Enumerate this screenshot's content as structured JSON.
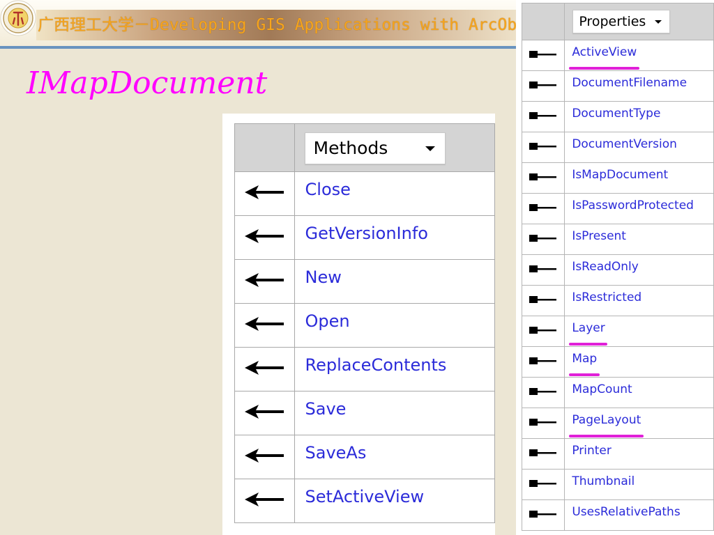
{
  "header": {
    "text": "广西理工大学－Developing GIS Applications with ArcObjects"
  },
  "page": {
    "title": "IMapDocument"
  },
  "methods_panel": {
    "dropdown_label": "Methods",
    "items": [
      {
        "label": "Close"
      },
      {
        "label": "GetVersionInfo"
      },
      {
        "label": "New"
      },
      {
        "label": "Open"
      },
      {
        "label": "ReplaceContents"
      },
      {
        "label": "Save"
      },
      {
        "label": "SaveAs"
      },
      {
        "label": "SetActiveView"
      }
    ],
    "icon": "method-arrow-icon"
  },
  "properties_panel": {
    "dropdown_label": "Properties",
    "icon": "property-arrow-icon",
    "highlight_color": "#e020d8",
    "items": [
      {
        "label": "ActiveView",
        "highlighted": true
      },
      {
        "label": "DocumentFilename",
        "highlighted": false
      },
      {
        "label": "DocumentType",
        "highlighted": false
      },
      {
        "label": "DocumentVersion",
        "highlighted": false
      },
      {
        "label": "IsMapDocument",
        "highlighted": false
      },
      {
        "label": "IsPasswordProtected",
        "highlighted": false
      },
      {
        "label": "IsPresent",
        "highlighted": false
      },
      {
        "label": "IsReadOnly",
        "highlighted": false
      },
      {
        "label": "IsRestricted",
        "highlighted": false
      },
      {
        "label": "Layer",
        "highlighted": true
      },
      {
        "label": "Map",
        "highlighted": true
      },
      {
        "label": "MapCount",
        "highlighted": false
      },
      {
        "label": "PageLayout",
        "highlighted": true
      },
      {
        "label": "Printer",
        "highlighted": false
      },
      {
        "label": "Thumbnail",
        "highlighted": false
      },
      {
        "label": "UsesRelativePaths",
        "highlighted": false
      }
    ]
  },
  "colors": {
    "title": "#ff00ff",
    "header_text": "#f7a51c",
    "link_text": "#2b2bd9",
    "header_rule": "#6993bf"
  }
}
